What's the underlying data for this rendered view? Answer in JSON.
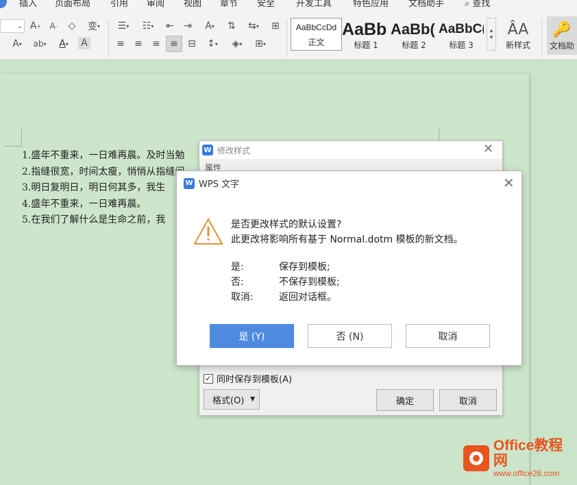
{
  "menu": [
    "插入",
    "页面布局",
    "引用",
    "审阅",
    "视图",
    "章节",
    "安全",
    "开发工具",
    "特色应用",
    "文档助手",
    "查找"
  ],
  "styles": [
    {
      "preview": "AaBbCcDd",
      "label": "正文"
    },
    {
      "preview": "AaBb",
      "label": "标题 1"
    },
    {
      "preview": "AaBb(",
      "label": "标题 2"
    },
    {
      "preview": "AaBbC(",
      "label": "标题 3"
    }
  ],
  "new_style_label": "新样式",
  "doc_helper_label": "文档助",
  "document": {
    "lines": [
      "1.盛年不重来，一日难再晨。及时当勉",
      "2.指缝很宽，时间太瘦，悄悄从指缝间",
      "3.明日复明日，明日何其多，我生",
      "4.盛年不重来，一日难再晨。",
      "5.在我们了解什么是生命之前，我"
    ]
  },
  "back_dialog": {
    "title": "修改样式",
    "section": "属性",
    "save_to_template": "同时保存到模板(A)",
    "format_button": "格式(O)",
    "ok_button": "确定",
    "cancel_button": "取消"
  },
  "front_dialog": {
    "title": "WPS 文字",
    "question": "是否更改样式的默认设置?",
    "detail": "此更改将影响所有基于 Normal.dotm 模板的新文档。",
    "options": [
      {
        "key": "是:",
        "desc": "保存到模板;"
      },
      {
        "key": "否:",
        "desc": "不保存到模板;"
      },
      {
        "key": "取消:",
        "desc": "返回对话框。"
      }
    ],
    "yes_button": "是 (Y)",
    "no_button": "否 (N)",
    "cancel_button": "取消"
  },
  "watermark": {
    "brand": "Office教程网",
    "url": "www.office26.com"
  }
}
